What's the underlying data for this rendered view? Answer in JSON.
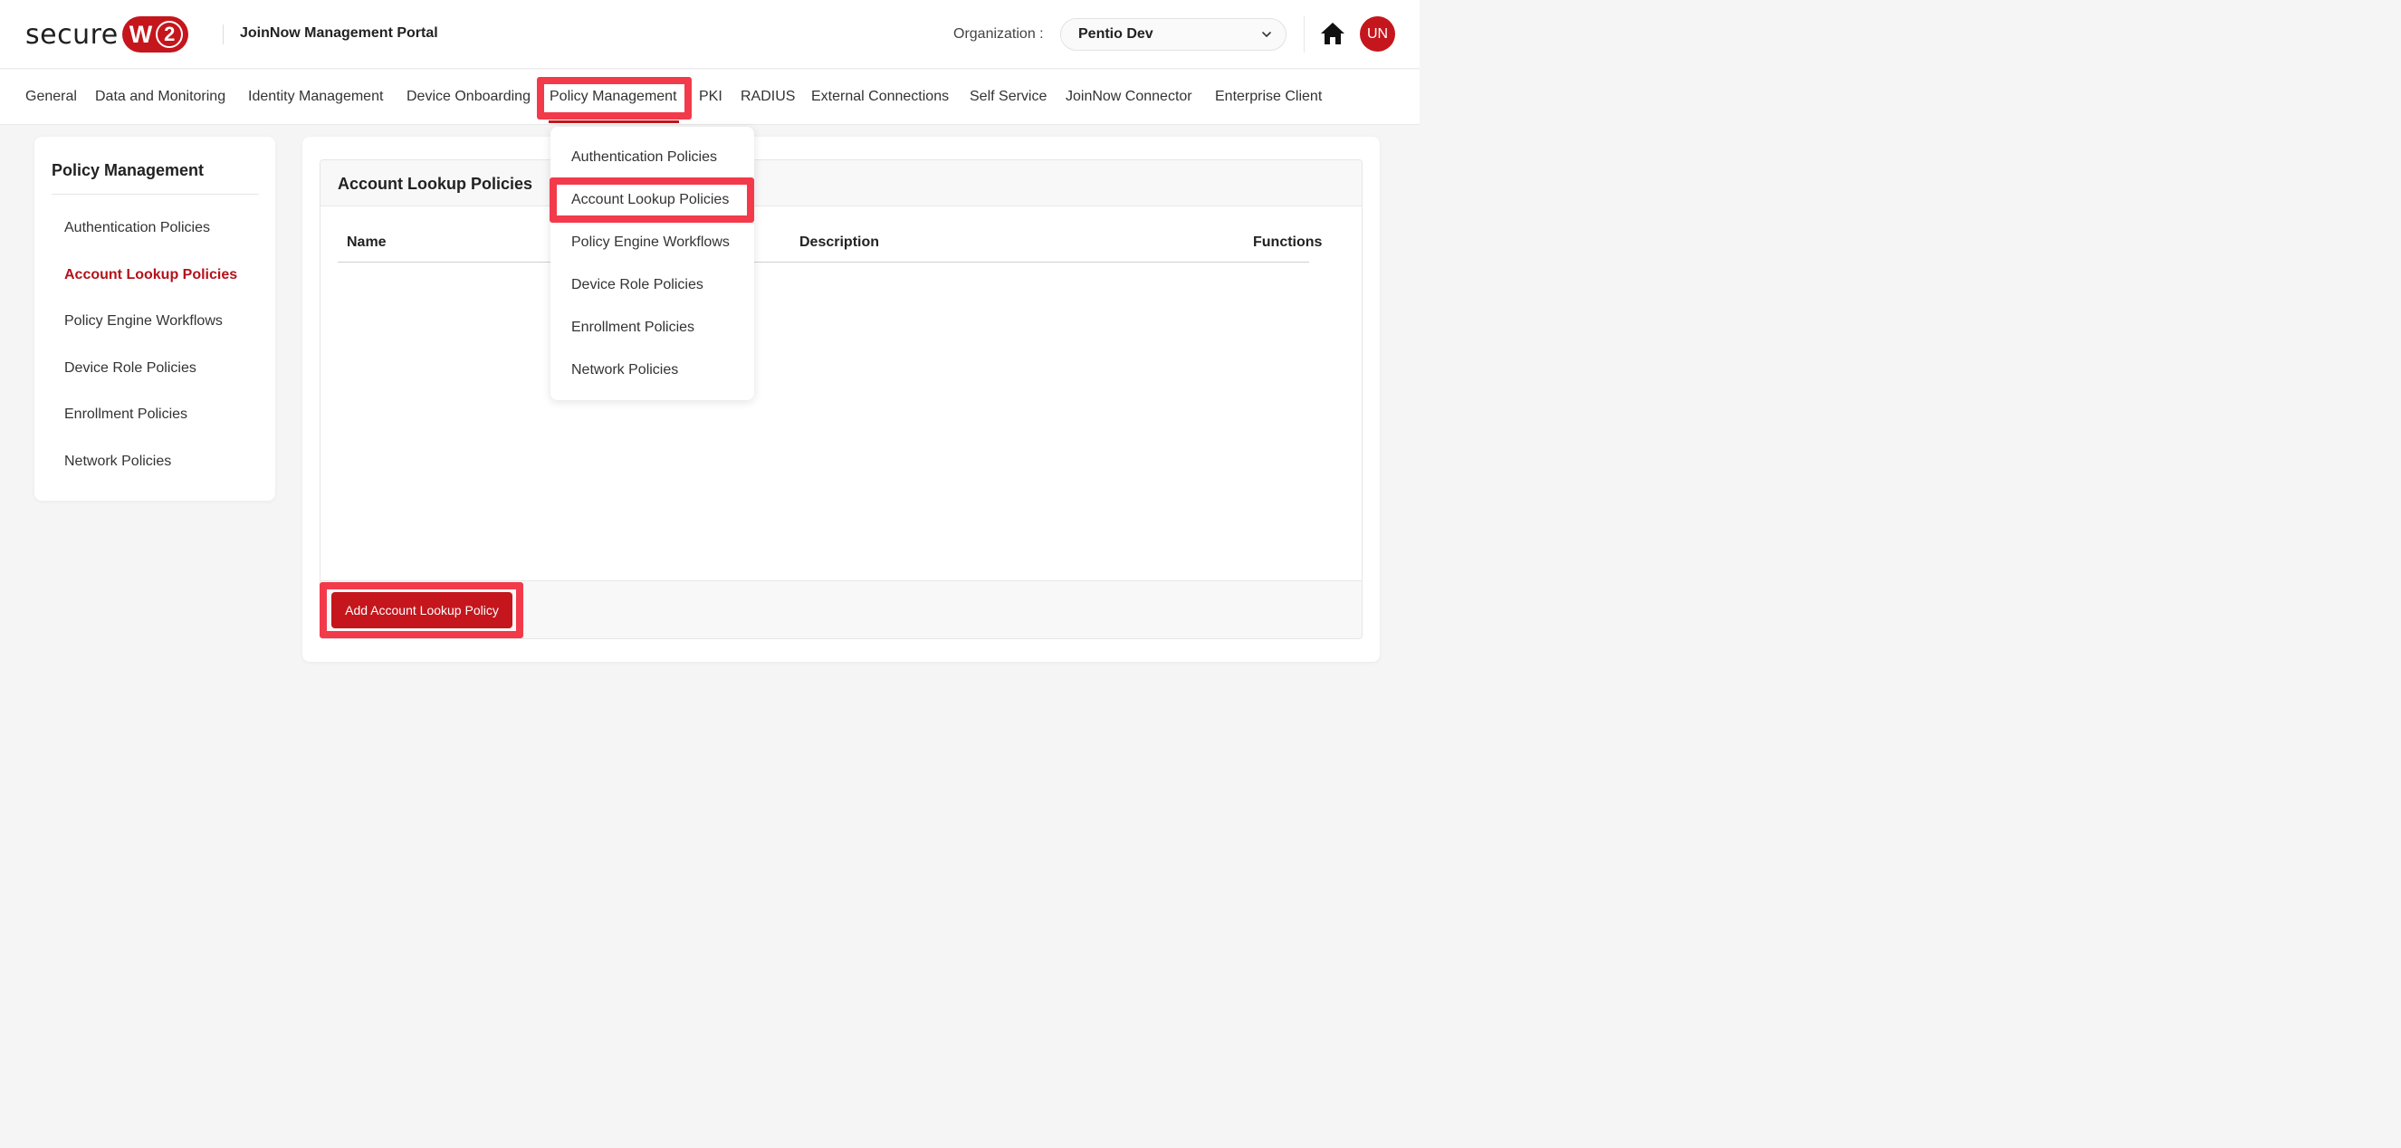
{
  "header": {
    "logo_text": "secure",
    "logo_badge_w": "W",
    "logo_badge_two": "2",
    "portal_title": "JoinNow Management Portal",
    "org_label": "Organization :",
    "org_value": "Pentio Dev",
    "avatar_initials": "UN",
    "icons": [
      "chevron-down-icon",
      "home-icon"
    ]
  },
  "nav": {
    "items": [
      "General",
      "Data and Monitoring",
      "Identity Management",
      "Device Onboarding",
      "Policy Management",
      "PKI",
      "RADIUS",
      "External Connections",
      "Self Service",
      "JoinNow Connector",
      "Enterprise Client"
    ],
    "active": "Policy Management"
  },
  "dropdown": {
    "items": [
      "Authentication Policies",
      "Account Lookup Policies",
      "Policy Engine Workflows",
      "Device Role Policies",
      "Enrollment Policies",
      "Network Policies"
    ],
    "highlighted": "Account Lookup Policies"
  },
  "sidebar": {
    "title": "Policy Management",
    "items": [
      "Authentication Policies",
      "Account Lookup Policies",
      "Policy Engine Workflows",
      "Device Role Policies",
      "Enrollment Policies",
      "Network Policies"
    ],
    "active": "Account Lookup Policies"
  },
  "main": {
    "panel_title": "Account Lookup Policies",
    "columns": [
      "Name",
      "Description",
      "Functions"
    ],
    "rows": [],
    "add_button_label": "Add Account Lookup Policy"
  },
  "colors": {
    "brand_red": "#c4161c",
    "highlight": "#f23a4b"
  }
}
